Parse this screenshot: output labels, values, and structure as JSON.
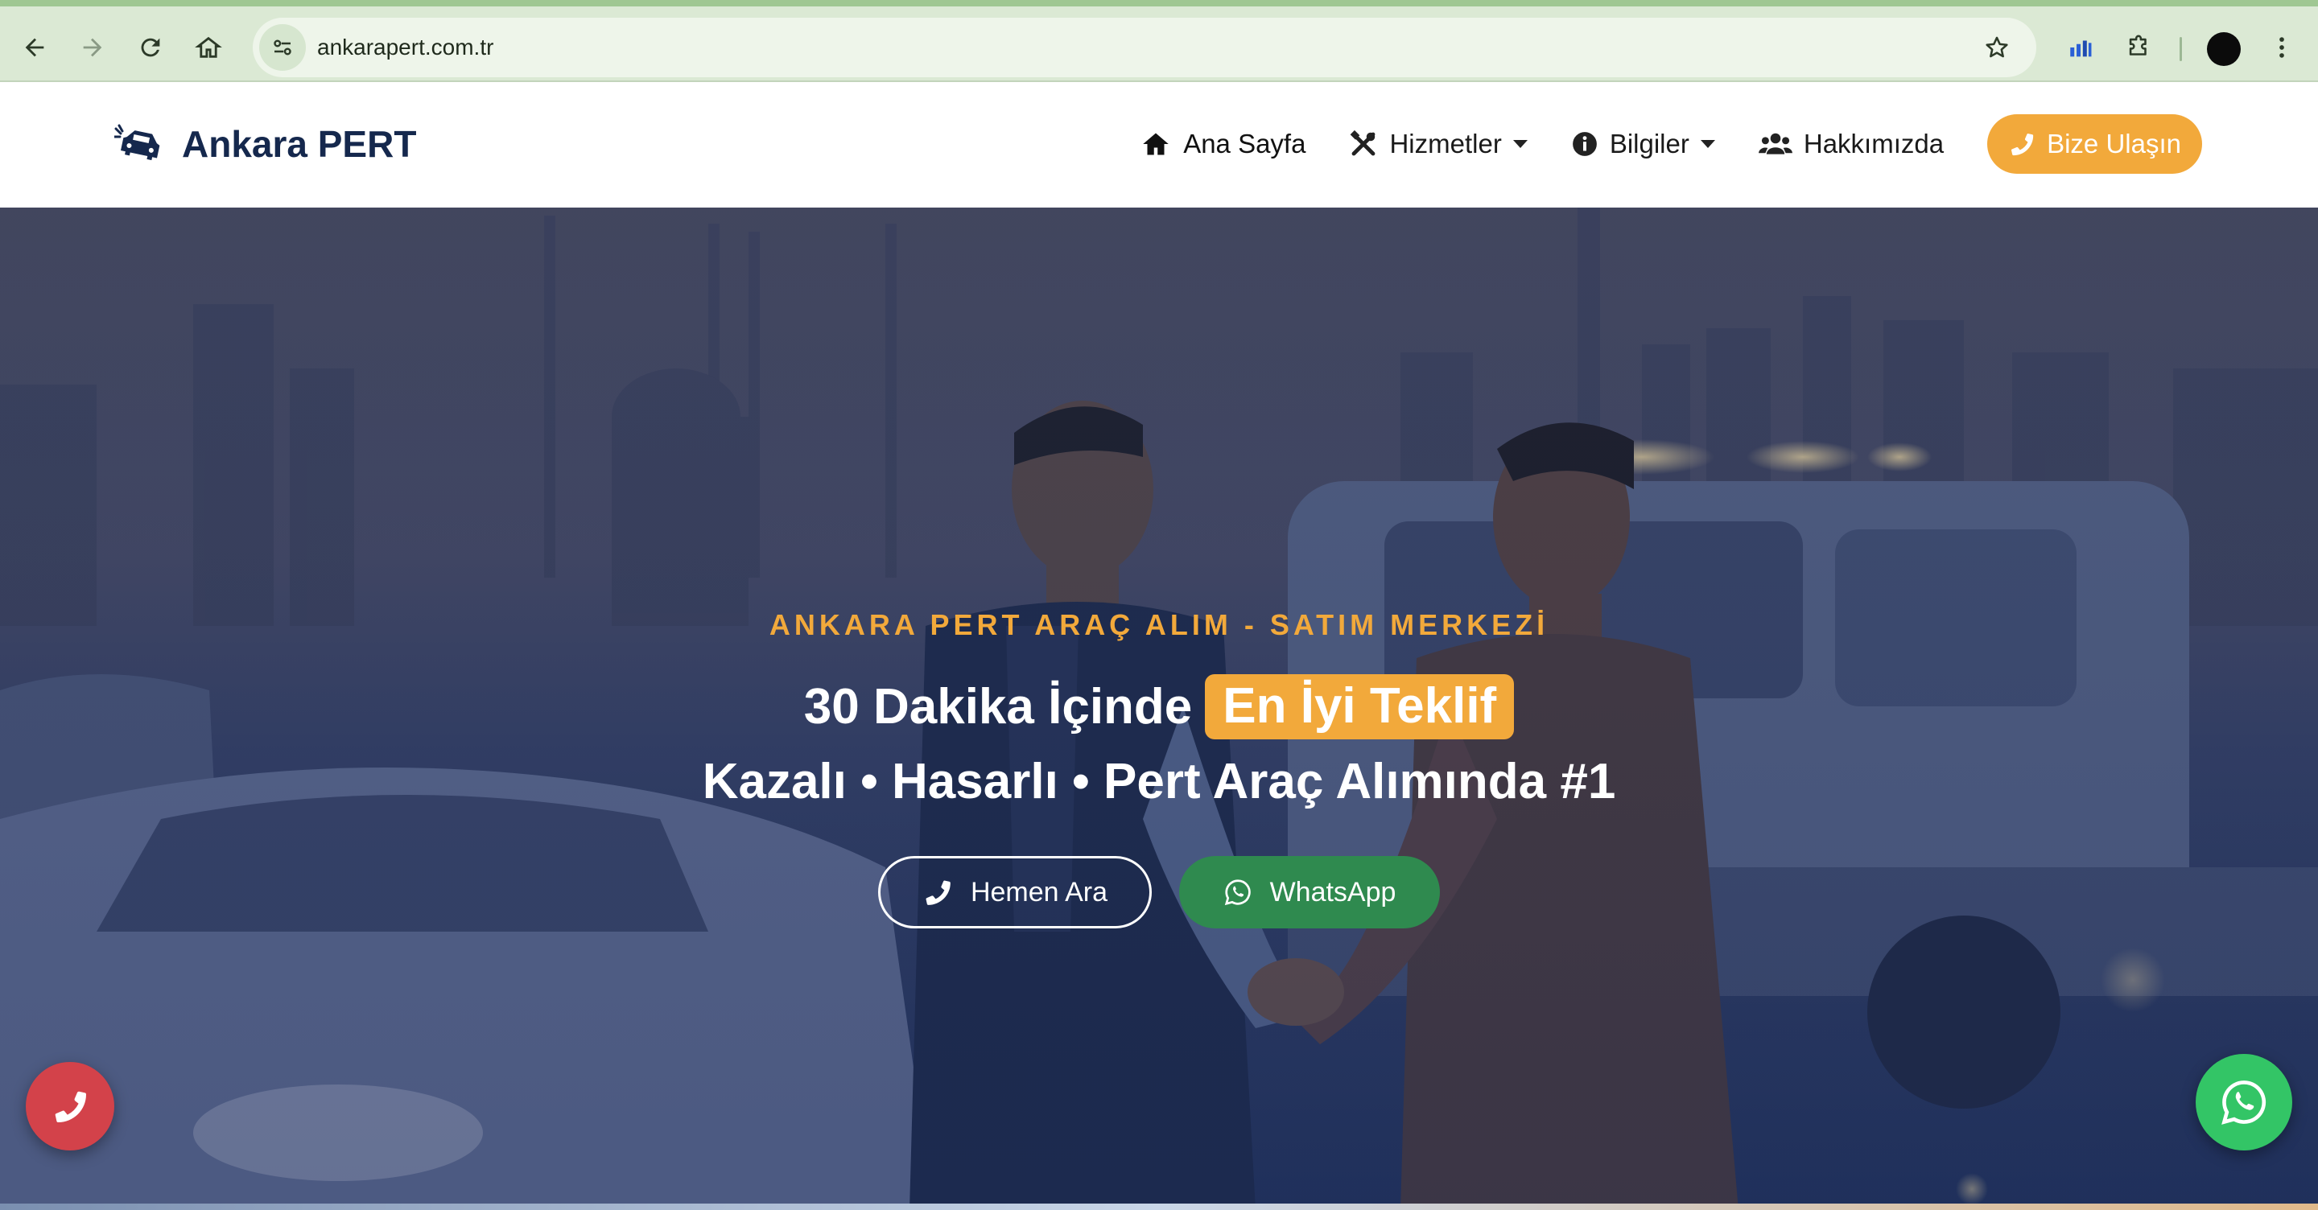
{
  "browser": {
    "url": "ankarapert.com.tr"
  },
  "navbar": {
    "brand": "Ankara PERT",
    "items": [
      {
        "label": "Ana Sayfa",
        "icon": "home-icon"
      },
      {
        "label": "Hizmetler",
        "icon": "tools-icon",
        "dropdown": true
      },
      {
        "label": "Bilgiler",
        "icon": "info-icon",
        "dropdown": true
      },
      {
        "label": "Hakkımızda",
        "icon": "users-icon"
      }
    ],
    "cta": "Bize Ulaşın"
  },
  "hero": {
    "eyebrow": "ANKARA PERT ARAÇ ALIM - SATIM MERKEZİ",
    "headline_lead": "30 Dakika İçinde",
    "headline_highlight": "En İyi Teklif",
    "headline2": "Kazalı • Hasarlı • Pert Araç Alımında #1",
    "call_button": "Hemen Ara",
    "whatsapp_button": "WhatsApp"
  },
  "colors": {
    "accent": "#f2a93b",
    "brand_text": "#15284d",
    "whatsapp_green": "#2f8a4f",
    "float_whatsapp": "#33c566",
    "float_phone": "#d3424a"
  }
}
